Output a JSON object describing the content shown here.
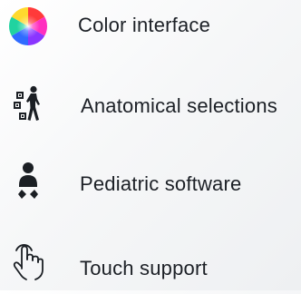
{
  "features": [
    {
      "label": "Color interface",
      "icon": "color-wheel-icon"
    },
    {
      "label": "Anatomical selections",
      "icon": "anatomy-selection-icon"
    },
    {
      "label": "Pediatric software",
      "icon": "baby-icon"
    },
    {
      "label": "Touch support",
      "icon": "touch-hand-icon"
    }
  ],
  "colors": {
    "text": "#1c2026",
    "icon": "#1b1f24",
    "background": "#f6f7f8"
  }
}
